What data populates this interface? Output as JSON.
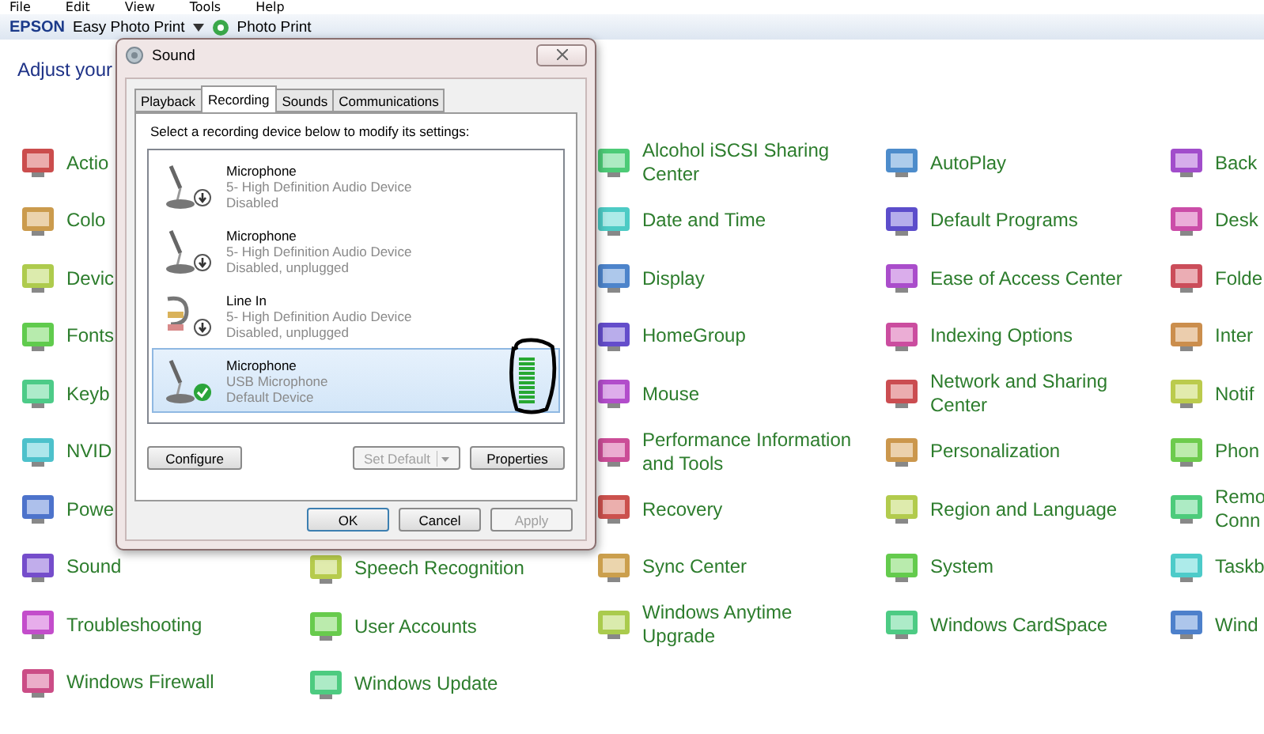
{
  "menu_bar": [
    "File",
    "Edit",
    "View",
    "Tools",
    "Help"
  ],
  "toolbar": {
    "brand": "EPSON",
    "app": "Easy Photo Print",
    "photo_print": "Photo Print"
  },
  "heading": "Adjust your",
  "columns": [
    {
      "items": [
        {
          "lines": [
            "Actio"
          ]
        },
        {
          "lines": [
            "Colo"
          ]
        },
        {
          "lines": [
            "Devic"
          ]
        },
        {
          "lines": [
            "Fonts"
          ]
        },
        {
          "lines": [
            "Keyb"
          ]
        },
        {
          "lines": [
            "NVID"
          ]
        },
        {
          "lines": [
            "Powe"
          ]
        },
        {
          "lines": [
            "Sound"
          ]
        },
        {
          "lines": [
            "Troubleshooting"
          ]
        },
        {
          "lines": [
            "Windows Firewall"
          ]
        }
      ]
    },
    {
      "items": [
        {
          "lines": [
            "Speech Recognition"
          ]
        },
        {
          "lines": [
            "User Accounts"
          ]
        },
        {
          "lines": [
            "Windows Update"
          ]
        }
      ]
    },
    {
      "items": [
        {
          "lines": [
            "Alcohol iSCSI Sharing",
            "Center"
          ]
        },
        {
          "lines": [
            "Date and Time"
          ]
        },
        {
          "lines": [
            "Display"
          ]
        },
        {
          "lines": [
            "HomeGroup"
          ]
        },
        {
          "lines": [
            "Mouse"
          ]
        },
        {
          "lines": [
            "Performance Information",
            "and Tools"
          ]
        },
        {
          "lines": [
            "Recovery"
          ]
        },
        {
          "lines": [
            "Sync Center"
          ]
        },
        {
          "lines": [
            "Windows Anytime",
            "Upgrade"
          ]
        }
      ]
    },
    {
      "items": [
        {
          "lines": [
            "AutoPlay"
          ]
        },
        {
          "lines": [
            "Default Programs"
          ]
        },
        {
          "lines": [
            "Ease of Access Center"
          ]
        },
        {
          "lines": [
            "Indexing Options"
          ]
        },
        {
          "lines": [
            "Network and Sharing",
            "Center"
          ]
        },
        {
          "lines": [
            "Personalization"
          ]
        },
        {
          "lines": [
            "Region and Language"
          ]
        },
        {
          "lines": [
            "System"
          ]
        },
        {
          "lines": [
            "Windows CardSpace"
          ]
        }
      ]
    },
    {
      "items": [
        {
          "lines": [
            "Back"
          ]
        },
        {
          "lines": [
            "Desk"
          ]
        },
        {
          "lines": [
            "Folde"
          ]
        },
        {
          "lines": [
            "Inter"
          ]
        },
        {
          "lines": [
            "Notif"
          ]
        },
        {
          "lines": [
            "Phon"
          ]
        },
        {
          "lines": [
            "Remo",
            "Conn"
          ]
        },
        {
          "lines": [
            "Taskb"
          ]
        },
        {
          "lines": [
            "Wind"
          ]
        }
      ]
    }
  ],
  "dialog": {
    "title": "Sound",
    "tabs": [
      {
        "label": "Playback",
        "selected": false
      },
      {
        "label": "Recording",
        "selected": true
      },
      {
        "label": "Sounds",
        "selected": false
      },
      {
        "label": "Communications",
        "selected": false
      }
    ],
    "instruction": "Select a recording device below to modify its settings:",
    "devices": [
      {
        "kind": "microphone",
        "name": "Microphone",
        "driver": "5- High Definition Audio Device",
        "status": "Disabled",
        "default": false,
        "selected": false
      },
      {
        "kind": "microphone",
        "name": "Microphone",
        "driver": "5- High Definition Audio Device",
        "status": "Disabled, unplugged",
        "default": false,
        "selected": false
      },
      {
        "kind": "line-in",
        "name": "Line In",
        "driver": "5- High Definition Audio Device",
        "status": "Disabled, unplugged",
        "default": false,
        "selected": false
      },
      {
        "kind": "microphone",
        "name": "Microphone",
        "driver": "USB Microphone",
        "status": "Default Device",
        "default": true,
        "selected": true,
        "level": 1,
        "circled": true
      }
    ],
    "panel_buttons": [
      {
        "label": "Configure",
        "disabled": false,
        "kind": "plain"
      },
      {
        "label": "Set Default",
        "disabled": true,
        "kind": "split"
      },
      {
        "label": "Properties",
        "disabled": false,
        "kind": "plain"
      }
    ],
    "buttons": [
      {
        "label": "OK",
        "disabled": false,
        "default": true
      },
      {
        "label": "Cancel",
        "disabled": false,
        "default": false
      },
      {
        "label": "Apply",
        "disabled": true,
        "default": false
      }
    ]
  }
}
